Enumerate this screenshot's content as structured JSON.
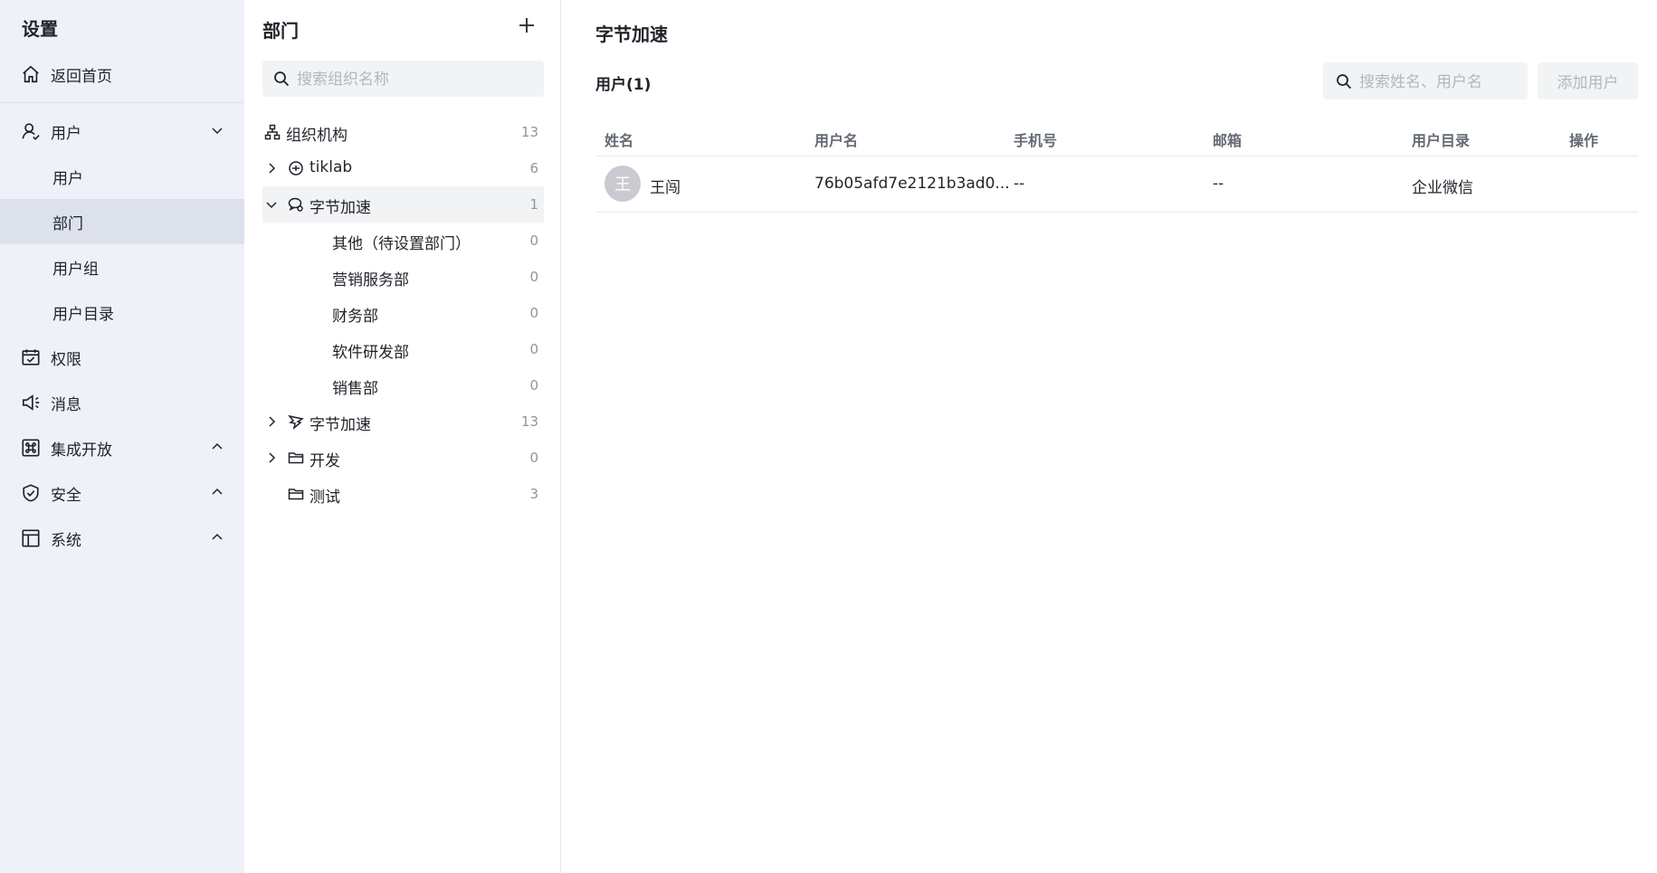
{
  "sidebar": {
    "title": "设置",
    "home_label": "返回首页",
    "users_group_label": "用户",
    "sub_users": "用户",
    "sub_departments": "部门",
    "sub_user_groups": "用户组",
    "sub_user_directory": "用户目录",
    "permissions_label": "权限",
    "messages_label": "消息",
    "integration_label": "集成开放",
    "security_label": "安全",
    "system_label": "系统"
  },
  "dept_panel": {
    "title": "部门",
    "search_placeholder": "搜索组织名称",
    "tree": [
      {
        "label": "组织机构",
        "count": "13"
      },
      {
        "label": "tiklab",
        "count": "6"
      },
      {
        "label": "字节加速",
        "count": "1"
      },
      {
        "label": "其他（待设置部门）",
        "count": "0"
      },
      {
        "label": "营销服务部",
        "count": "0"
      },
      {
        "label": "财务部",
        "count": "0"
      },
      {
        "label": "软件研发部",
        "count": "0"
      },
      {
        "label": "销售部",
        "count": "0"
      },
      {
        "label": "字节加速",
        "count": "13"
      },
      {
        "label": "开发",
        "count": "0"
      },
      {
        "label": "测试",
        "count": "3"
      }
    ]
  },
  "main": {
    "title": "字节加速",
    "users_count_label": "用户(1)",
    "search_placeholder": "搜索姓名、用户名",
    "add_user_label": "添加用户",
    "columns": [
      "姓名",
      "用户名",
      "手机号",
      "邮箱",
      "用户目录",
      "操作"
    ],
    "rows": [
      {
        "avatar": "王",
        "name": "王闯",
        "username": "76b05afd7e2121b3ad0...",
        "phone": "--",
        "email": "--",
        "directory": "企业微信",
        "actions": ""
      }
    ]
  },
  "colors": {
    "sidebar_bg": "#eff1f9",
    "active_item_bg": "#dde1ec",
    "text": "#1f2329",
    "muted": "#8f959e",
    "avatar_bg": "#c9cbd0"
  }
}
